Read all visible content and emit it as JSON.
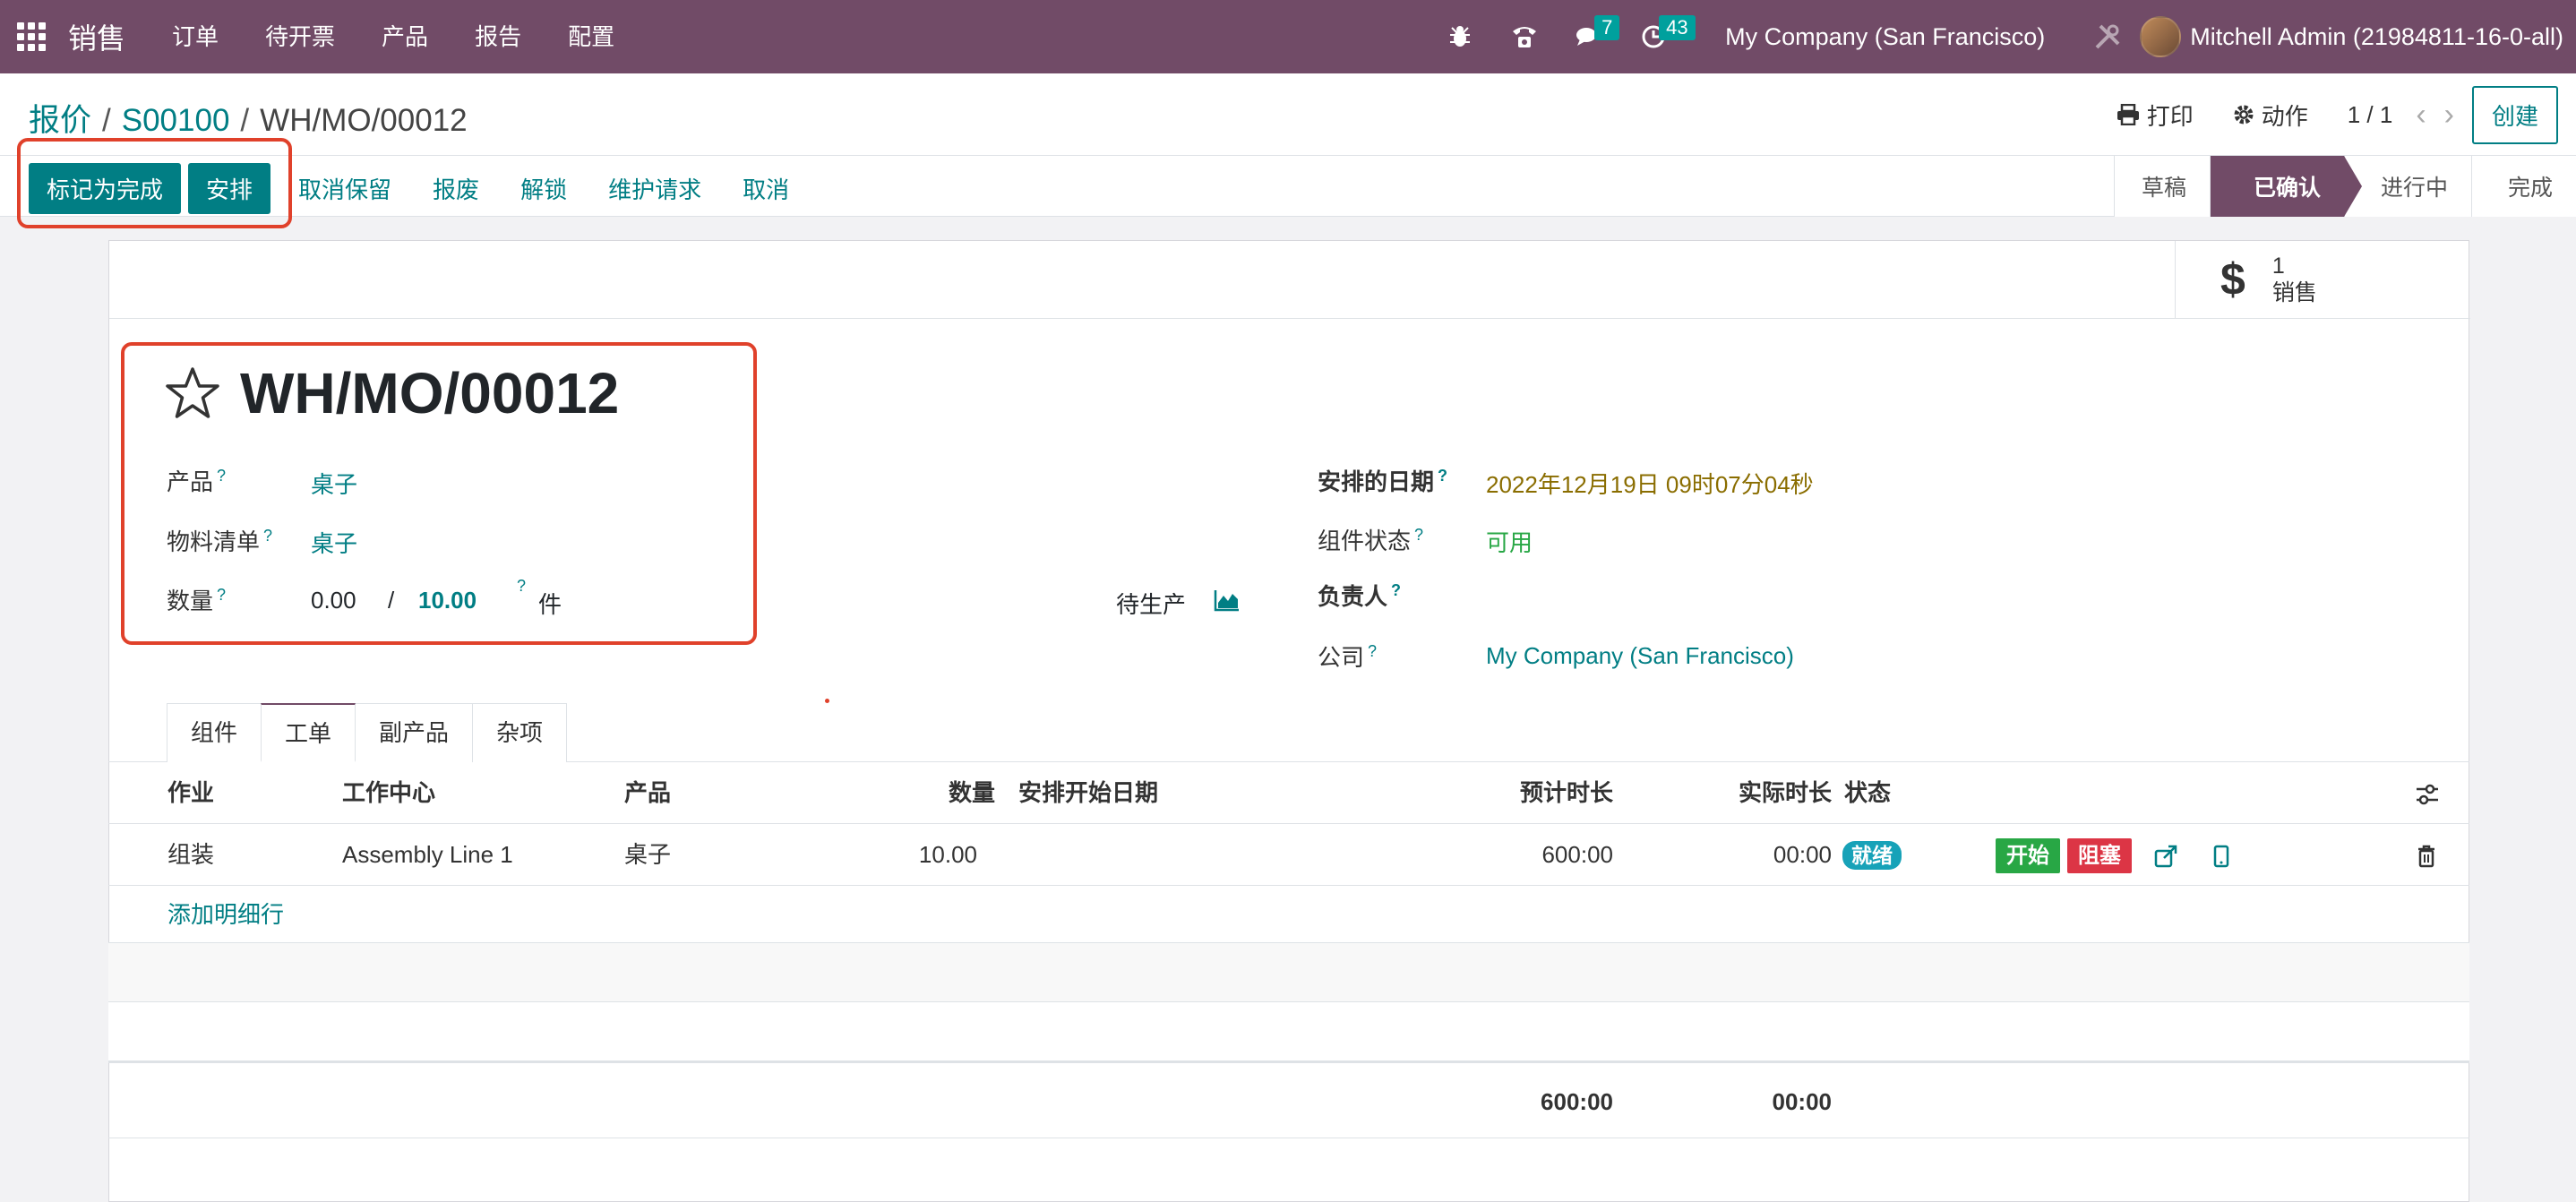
{
  "navbar": {
    "app_name": "销售",
    "menu": [
      "订单",
      "待开票",
      "产品",
      "报告",
      "配置"
    ],
    "chat_count": "7",
    "activity_count": "43",
    "company": "My Company (San Francisco)",
    "user": "Mitchell Admin (21984811-16-0-all)"
  },
  "breadcrumb": {
    "root": "报价",
    "sep": "/",
    "order": "S00100",
    "current": "WH/MO/00012"
  },
  "control": {
    "print": "打印",
    "action": "动作",
    "pager": "1 / 1",
    "create": "创建"
  },
  "actions": {
    "mark_done": "标记为完成",
    "plan": "安排",
    "unreserve": "取消保留",
    "scrap": "报废",
    "unlock": "解锁",
    "maintenance": "维护请求",
    "cancel": "取消"
  },
  "status_steps": [
    "草稿",
    "已确认",
    "进行中",
    "完成"
  ],
  "status_active": "已确认",
  "smart_button": {
    "count": "1",
    "label": "销售"
  },
  "record": {
    "name": "WH/MO/00012",
    "product_label": "产品",
    "product": "桌子",
    "bom_label": "物料清单",
    "bom": "桌子",
    "qty_label": "数量",
    "qty_produced": "0.00",
    "qty_sep": "/",
    "qty_total": "10.00",
    "uom": "件",
    "to_produce": "待生产",
    "scheduled_label": "安排的日期",
    "scheduled": "2022年12月19日 09时07分04秒",
    "components_label": "组件状态",
    "components": "可用",
    "responsible_label": "负责人",
    "company_label": "公司",
    "company": "My Company (San Francisco)"
  },
  "tabs": [
    "组件",
    "工单",
    "副产品",
    "杂项"
  ],
  "active_tab": "工单",
  "table": {
    "headers": {
      "operation": "作业",
      "workcenter": "工作中心",
      "product": "产品",
      "qty": "数量",
      "start": "安排开始日期",
      "expected": "预计时长",
      "real": "实际时长",
      "state": "状态"
    },
    "rows": [
      {
        "operation": "组装",
        "workcenter": "Assembly Line 1",
        "product": "桌子",
        "qty": "10.00",
        "start": "",
        "expected": "600:00",
        "real": "00:00",
        "state": "就绪",
        "start_btn": "开始",
        "block_btn": "阻塞"
      }
    ],
    "add_line": "添加明细行",
    "total_expected": "600:00",
    "total_real": "00:00"
  },
  "colors": {
    "brand": "#714b67",
    "link": "#017e84",
    "highlight": "#e0412b"
  },
  "help_mark": "?"
}
